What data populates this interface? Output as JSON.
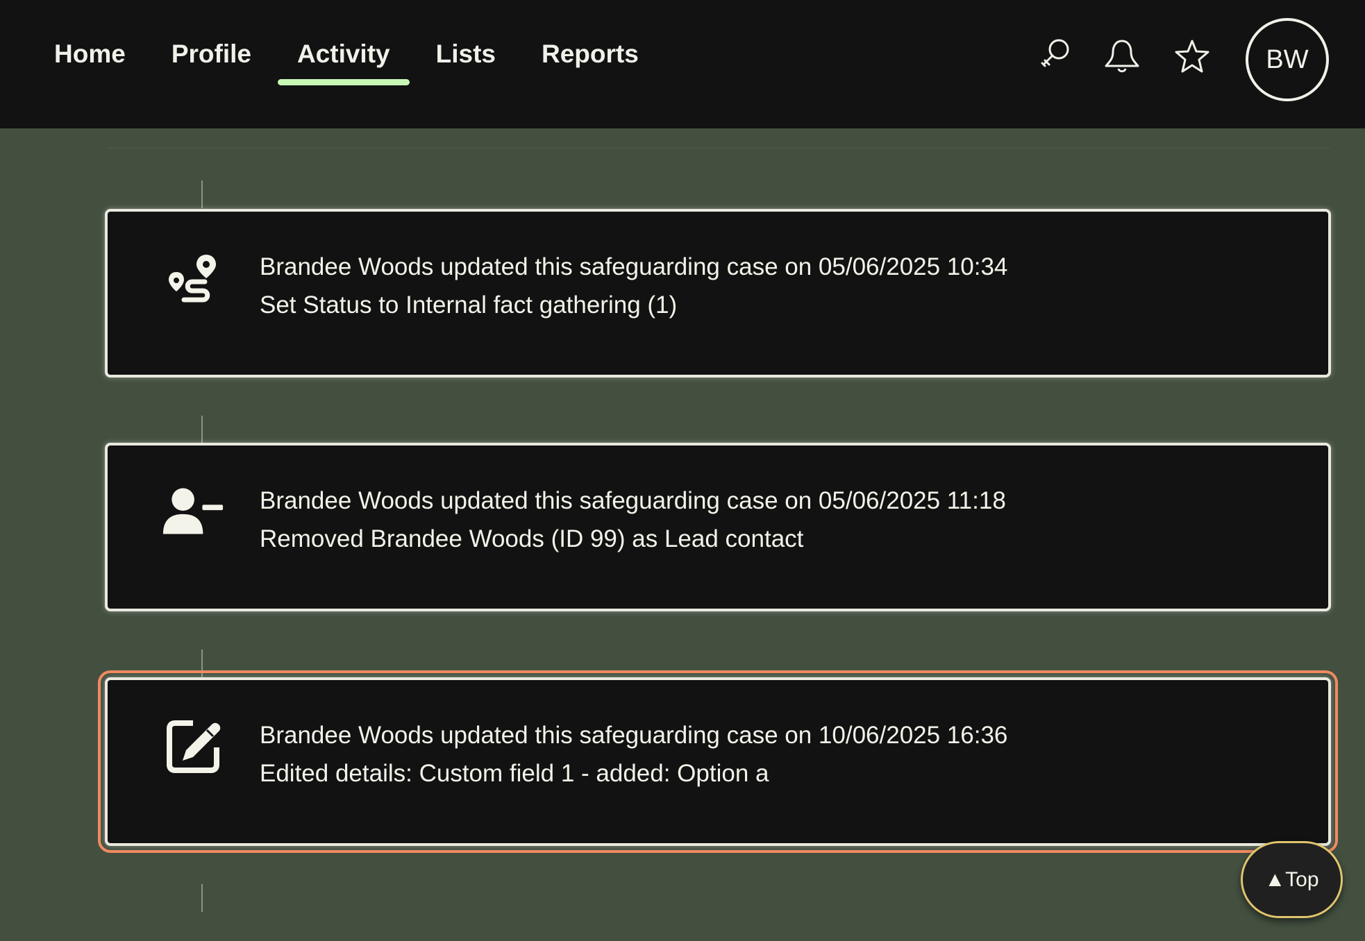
{
  "nav": {
    "items": [
      {
        "label": "Home"
      },
      {
        "label": "Profile"
      },
      {
        "label": "Activity",
        "active": true
      },
      {
        "label": "Lists"
      },
      {
        "label": "Reports"
      }
    ],
    "icons": [
      "search-icon",
      "bell-icon",
      "star-icon"
    ],
    "avatar_initials": "BW"
  },
  "activity": [
    {
      "icon": "route-icon",
      "line1": "Brandee Woods updated this safeguarding case on 05/06/2025 10:34",
      "line2": "Set Status to Internal fact gathering (1)"
    },
    {
      "icon": "user-minus-icon",
      "line1": "Brandee Woods updated this safeguarding case on 05/06/2025 11:18",
      "line2": "Removed Brandee Woods (ID 99) as Lead contact"
    },
    {
      "icon": "edit-icon",
      "line1": "Brandee Woods updated this safeguarding case on 10/06/2025 16:36",
      "line2": "Edited details: Custom field 1 - added: Option a",
      "focused": true
    }
  ],
  "top_button": {
    "label": "▲Top"
  },
  "colors": {
    "page_background": "#435040",
    "bar_background": "#121212",
    "active_tab": "#c8f7b5",
    "focus_ring": "#f08a63",
    "top_button_border": "#e0c56d"
  }
}
